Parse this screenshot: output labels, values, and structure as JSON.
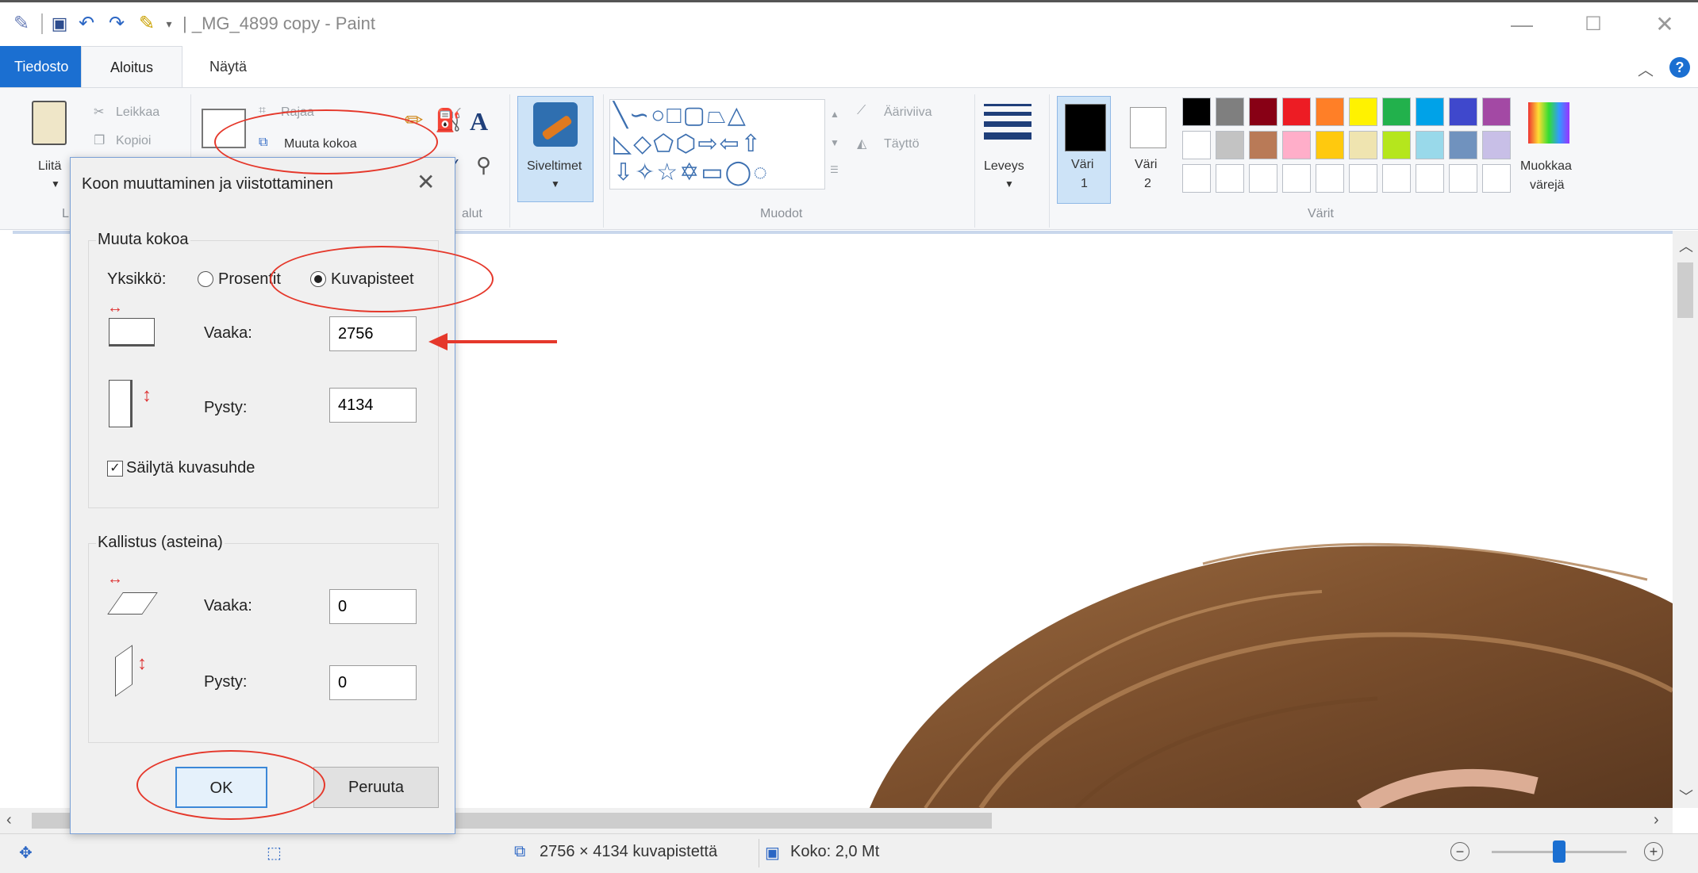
{
  "window": {
    "title": "| _MG_4899 copy - Paint",
    "minimize_glyph": "—",
    "maximize_glyph": "☐",
    "close_glyph": "✕"
  },
  "tabs": {
    "file": "Tiedosto",
    "home": "Aloitus",
    "view": "Näytä"
  },
  "ribbon": {
    "clipboard": {
      "paste": "Liitä",
      "cut": "Leikkaa",
      "copy": "Kopioi"
    },
    "image": {
      "crop": "Rajaa",
      "resize": "Muuta kokoa"
    },
    "tools": {
      "label": "alut"
    },
    "brushes": {
      "label": "Siveltimet"
    },
    "shapes": {
      "outline": "Ääriviiva",
      "fill": "Täyttö",
      "group_label": "Muodot"
    },
    "size": {
      "label": "Leveys"
    },
    "color1": {
      "line1": "Väri",
      "line2": "1"
    },
    "color2": {
      "line1": "Väri",
      "line2": "2"
    },
    "colors": {
      "group_label": "Värit",
      "edit_line1": "Muokkaa",
      "edit_line2": "värejä"
    },
    "clipboard_group_label": "L"
  },
  "palette": {
    "row1": [
      "#000000",
      "#7f7f7f",
      "#880015",
      "#ed1c24",
      "#ff7f27",
      "#fff200",
      "#22b14c",
      "#00a2e8",
      "#3f48cc",
      "#a349a4"
    ],
    "row2": [
      "#ffffff",
      "#c3c3c3",
      "#b97a57",
      "#ffaec9",
      "#ffc90e",
      "#efe4b0",
      "#b5e61d",
      "#99d9ea",
      "#7092be",
      "#c8bfe7"
    ],
    "row3": [
      "#ffffff",
      "#ffffff",
      "#ffffff",
      "#ffffff",
      "#ffffff",
      "#ffffff",
      "#ffffff",
      "#ffffff",
      "#ffffff",
      "#ffffff"
    ],
    "color1": "#000000",
    "color2": "#ffffff"
  },
  "dialog": {
    "title": "Koon muuttaminen ja viistottaminen",
    "resize_legend": "Muuta kokoa",
    "unit_label": "Yksikkö:",
    "unit_percent": "Prosentit",
    "unit_pixels": "Kuvapisteet",
    "horizontal_label": "Vaaka:",
    "horizontal_value": "2756",
    "vertical_label": "Pysty:",
    "vertical_value": "4134",
    "keep_ratio": "Säilytä kuvasuhde",
    "skew_legend": "Kallistus (asteina)",
    "skew_h_label": "Vaaka:",
    "skew_h_value": "0",
    "skew_v_label": "Pysty:",
    "skew_v_value": "0",
    "ok": "OK",
    "cancel": "Peruuta"
  },
  "status": {
    "dimensions": "2756 × 4134 kuvapistettä",
    "size": "Koko: 2,0 Mt"
  },
  "zoom": {
    "slider_level": 0.5
  },
  "annotation_color": "#e5382b"
}
